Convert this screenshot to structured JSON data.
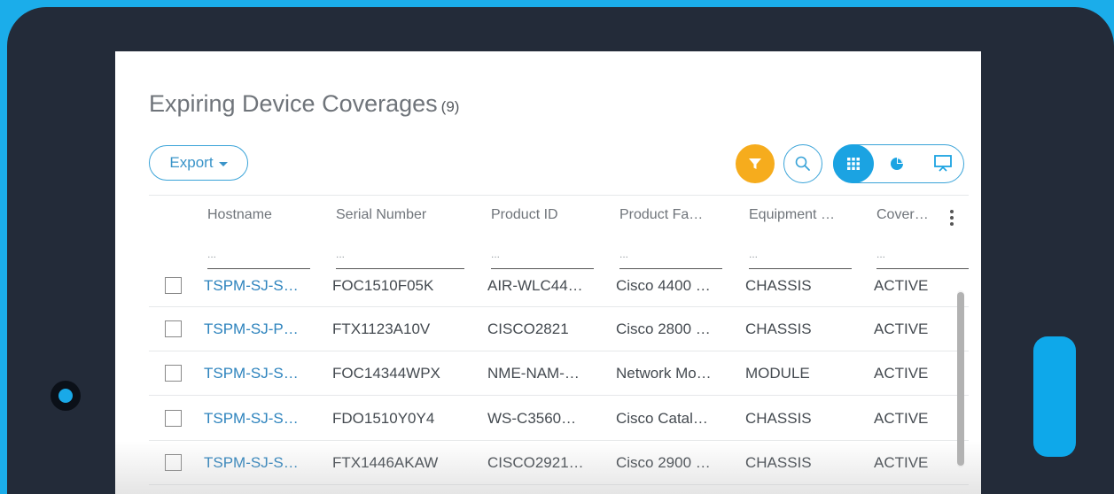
{
  "page": {
    "title": "Expiring Device Coverages",
    "count": "(9)"
  },
  "toolbar": {
    "export_label": "Export"
  },
  "icons": {
    "filter": "filter-icon",
    "search": "search-icon",
    "grid": "grid-view-icon",
    "pie": "pie-chart-icon",
    "presentation": "presentation-icon",
    "more": "more-vertical-icon"
  },
  "colors": {
    "background": "#1badea",
    "tablet": "#232b39",
    "accent": "#1ba3e2",
    "filter": "#f6ac1d",
    "link": "#2d83bd"
  },
  "table": {
    "columns": [
      "Hostname",
      "Serial Number",
      "Product ID",
      "Product Fa…",
      "Equipment …",
      "Coverag"
    ],
    "filter_placeholder": "...",
    "rows": [
      [
        "TSPM-SJ-S…",
        "FOC1510F05K",
        "AIR-WLC44…",
        "Cisco 4400 …",
        "CHASSIS",
        "ACTIVE"
      ],
      [
        "TSPM-SJ-P…",
        "FTX1123A10V",
        "CISCO2821",
        "Cisco 2800 …",
        "CHASSIS",
        "ACTIVE"
      ],
      [
        "TSPM-SJ-S…",
        "FOC14344WPX",
        "NME-NAM-…",
        "Network Mo…",
        "MODULE",
        "ACTIVE"
      ],
      [
        "TSPM-SJ-S…",
        "FDO1510Y0Y4",
        "WS-C3560…",
        "Cisco Catal…",
        "CHASSIS",
        "ACTIVE"
      ],
      [
        "TSPM-SJ-S…",
        "FTX1446AKAW",
        "CISCO2921…",
        "Cisco 2900 …",
        "CHASSIS",
        "ACTIVE"
      ]
    ]
  }
}
